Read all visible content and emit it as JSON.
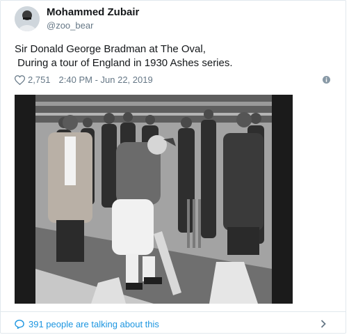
{
  "tweet": {
    "display_name": "Mohammed Zubair",
    "handle": "@zoo_bear",
    "text": "Sir Donald George Bradman at The Oval,\n During a tour of England in 1930 Ashes series.",
    "like_count": "2,751",
    "timestamp": "2:40 PM - Jun 22, 2019",
    "icons": [
      "heart-icon",
      "info-icon",
      "speech-bubble-icon",
      "chevron-right-icon"
    ]
  },
  "footer": {
    "talking_label": "391 people are talking about this"
  },
  "colors": {
    "text": "#14171a",
    "secondary": "#657786",
    "link": "#1b95e0",
    "border": "#e1e8ed"
  }
}
